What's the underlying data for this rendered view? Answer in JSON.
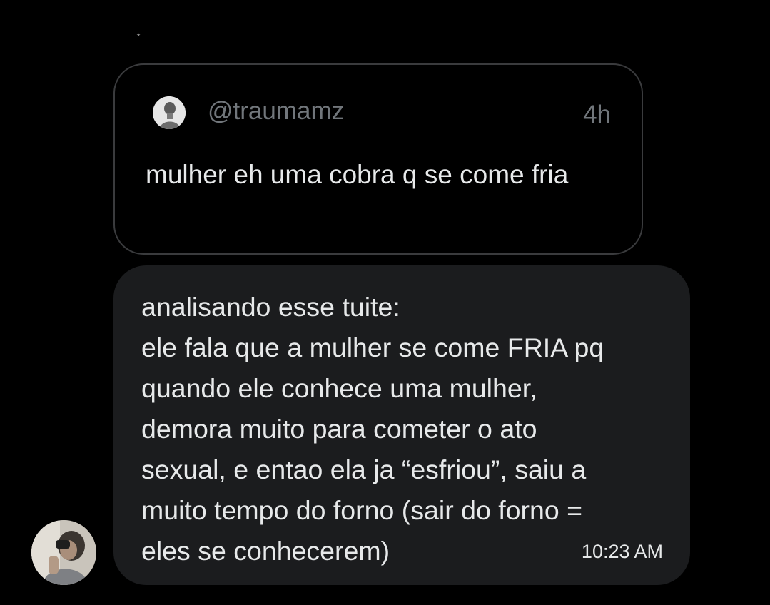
{
  "header": {
    "sparkle_icon": "sparkle-icon"
  },
  "quoted_post": {
    "handle": "@traumamz",
    "time": "4h",
    "text": "mulher eh uma cobra q se come fria",
    "avatar_icon": "avatar"
  },
  "message": {
    "lines": [
      "analisando esse tuite:",
      "ele fala que a mulher se come FRIA pq",
      "quando ele conhece uma mulher,",
      "demora muito para cometer o ato",
      "sexual, e entao ela ja “esfriou”, saiu a",
      "muito tempo do forno (sair do forno =",
      "eles se conhecerem)"
    ],
    "timestamp": "10:23 AM",
    "sender_avatar_icon": "avatar",
    "bubble_color": "#1b1c1e"
  },
  "colors": {
    "background": "#000000",
    "text_primary": "#e7e9ea",
    "text_secondary": "#71767b",
    "card_border": "#3a3b3d"
  }
}
